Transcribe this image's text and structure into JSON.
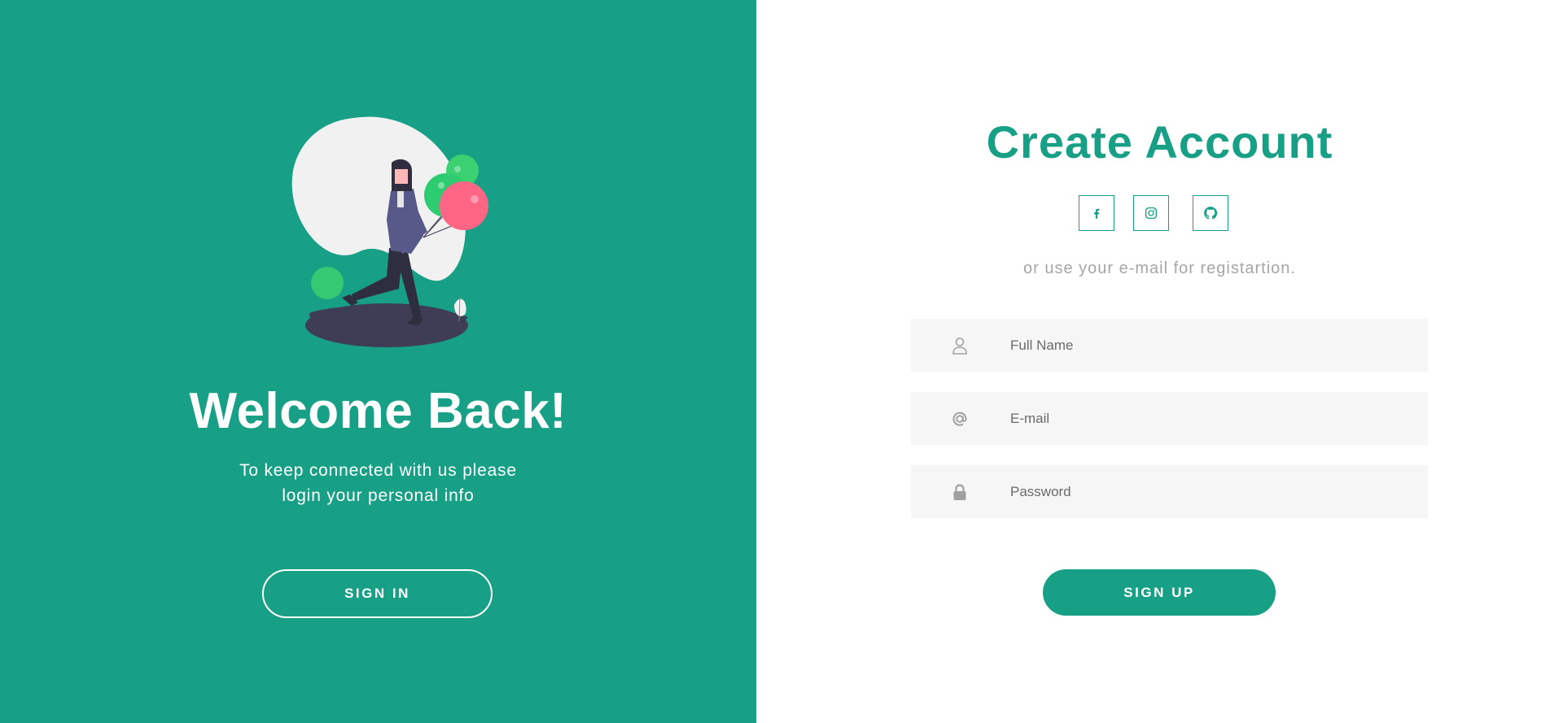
{
  "left": {
    "title": "Welcome Back!",
    "text_line1": "To keep connected with us please",
    "text_line2": "login your personal info",
    "signin_label": "SIGN IN",
    "illustration": "woman-with-balloons-illustration"
  },
  "right": {
    "title": "Create Account",
    "social": [
      {
        "icon": "facebook-icon"
      },
      {
        "icon": "instagram-icon"
      },
      {
        "icon": "github-icon"
      }
    ],
    "subtitle": "or use your e-mail for registartion.",
    "fields": {
      "name_placeholder": "Full Name",
      "email_placeholder": "E-mail",
      "password_placeholder": "Password"
    },
    "signup_label": "SIGN UP"
  },
  "colors": {
    "accent": "#17a085",
    "field_bg": "#f6f6f6",
    "muted": "#a6a6a6"
  }
}
